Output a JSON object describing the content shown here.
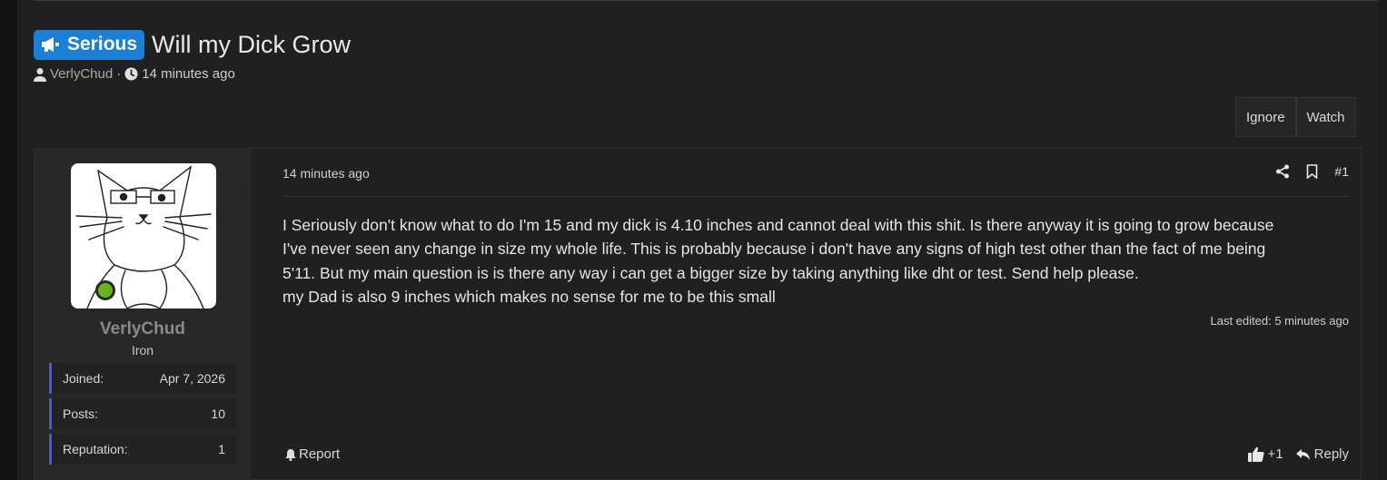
{
  "thread": {
    "prefix": "Serious",
    "title": "Will my Dick Grow",
    "author": "VerlyChud",
    "separator": "·",
    "time": "14 minutes ago"
  },
  "actions": {
    "ignore": "Ignore",
    "watch": "Watch"
  },
  "user": {
    "name": "VerlyChud",
    "title": "Iron",
    "stats": [
      {
        "label": "Joined:",
        "value": "Apr 7, 2026"
      },
      {
        "label": "Posts:",
        "value": "10"
      },
      {
        "label": "Reputation:",
        "value": "1"
      }
    ],
    "status_color": "#6cb319"
  },
  "post": {
    "date": "14 minutes ago",
    "number": "#1",
    "body_lines": [
      "I Seriously don't know what to do I'm 15 and my dick is 4.10 inches and cannot deal with this shit. Is there anyway it is going to grow because",
      "I've never seen any change in size my whole life. This is probably because i don't have any signs of high test other than the fact of me being",
      "5'11. But my main question is is there any way i can get a bigger size by taking anything like dht or test. Send help please.",
      "my Dad is also 9 inches which makes no sense for me to be this small"
    ],
    "edited": "Last edited: 5 minutes ago",
    "report": "Report",
    "like": "+1",
    "reply": "Reply"
  },
  "colors": {
    "prefix_bg": "#1c7fd6",
    "accent_border": "#4f5bbd"
  }
}
